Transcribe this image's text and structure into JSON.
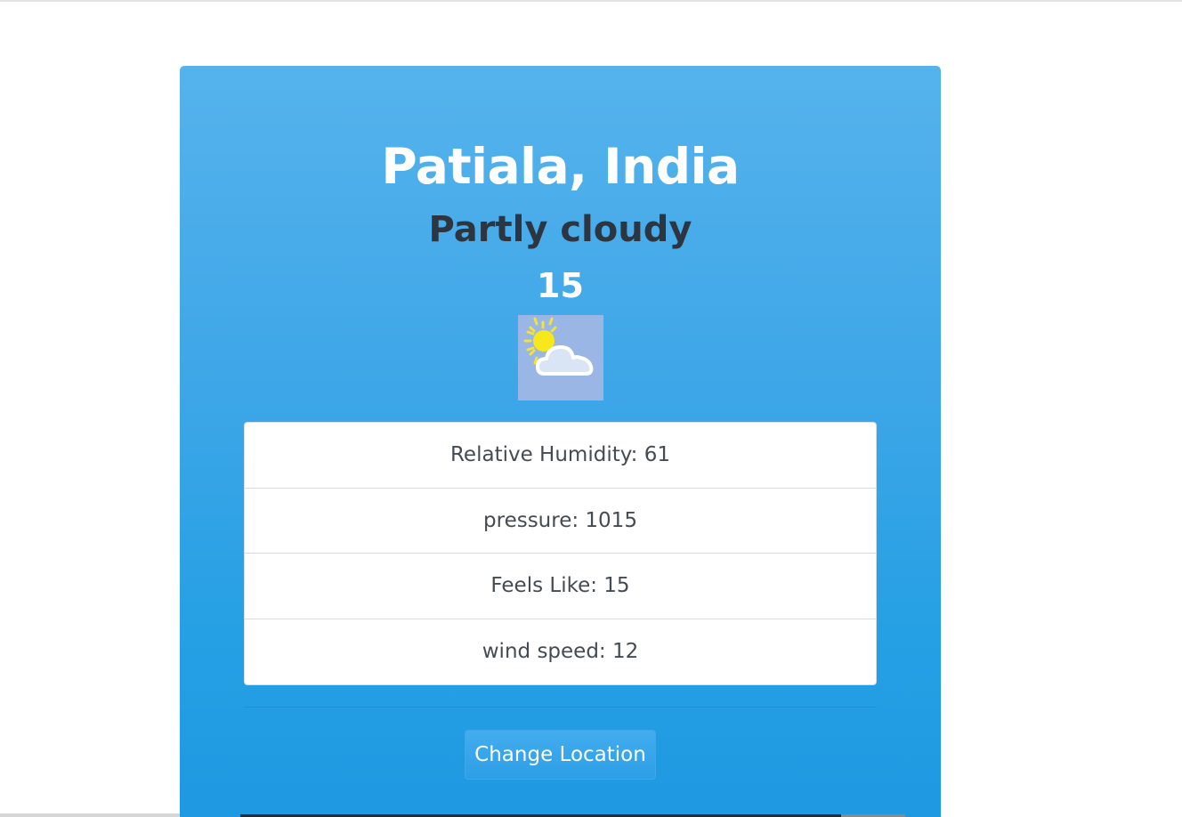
{
  "location": "Patiala, India",
  "condition": "Partly cloudy",
  "temperature": "15",
  "icon": "partly-cloudy-icon",
  "details": [
    {
      "text": "Relative Humidity: 61"
    },
    {
      "text": "pressure: 1015"
    },
    {
      "text": "Feels Like: 15"
    },
    {
      "text": "wind speed: 12"
    }
  ],
  "button": {
    "label": "Change Location"
  },
  "colors": {
    "card_top": "#55b3ec",
    "card_bottom": "#1e99e2",
    "icon_bg": "#99b6e4"
  }
}
